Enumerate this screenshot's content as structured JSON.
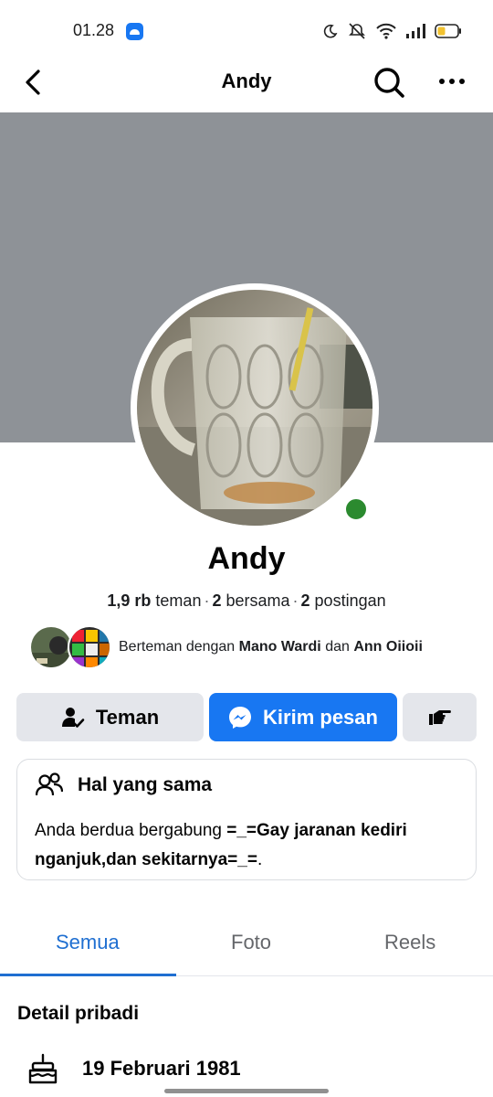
{
  "status_bar": {
    "time": "01.28",
    "icons": [
      "app-notification-icon",
      "moon-icon",
      "silent-icon",
      "wifi-icon",
      "signal-icon",
      "battery-icon"
    ]
  },
  "nav": {
    "title": "Andy",
    "icons": [
      "back-arrow-icon",
      "search-icon",
      "more-dots-icon"
    ]
  },
  "profile": {
    "name": "Andy",
    "online": true,
    "stats": {
      "friends_count": "1,9 rb",
      "friends_label": "teman",
      "mutual_count": "2",
      "mutual_label": "bersama",
      "posts_count": "2",
      "posts_label": "postingan"
    },
    "mutual": {
      "prefix": "Berteman dengan",
      "friend1": "Mano Wardi",
      "conj": "dan",
      "friend2": "Ann Oiioii"
    }
  },
  "actions": {
    "friend_label": "Teman",
    "message_label": "Kirim pesan",
    "more_icon": "poke-hand-icon"
  },
  "common": {
    "title": "Hal yang sama",
    "text_prefix": "Anda berdua bergabung",
    "group_name": "=_=Gay jaranan kediri nganjuk,dan sekitarnya=_=",
    "text_suffix": "."
  },
  "tabs": [
    {
      "label": "Semua",
      "active": true
    },
    {
      "label": "Foto",
      "active": false
    },
    {
      "label": "Reels",
      "active": false
    }
  ],
  "details": {
    "title": "Detail pribadi",
    "birthday": "19 Februari 1981"
  },
  "colors": {
    "brand_blue": "#1877f2",
    "online_green": "#2b8a2f",
    "cover_gray": "#8e9297",
    "button_gray": "#e4e6eb"
  }
}
